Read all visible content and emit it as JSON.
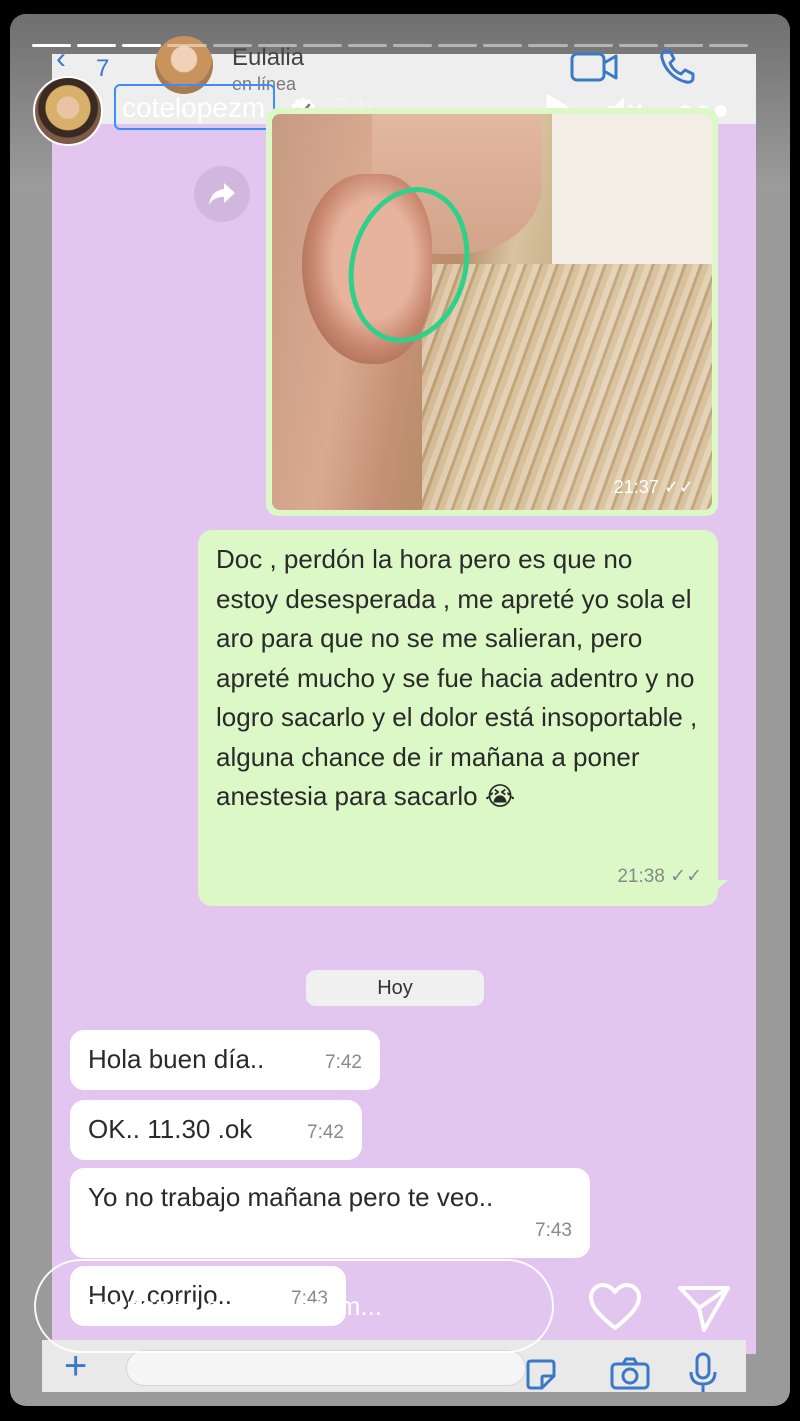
{
  "story": {
    "username": "cotelopezm",
    "time_ago": "7 h",
    "progress_segments": 16,
    "progress_current": 3,
    "reply_placeholder": "Responde a cotelopezm..."
  },
  "whatsapp": {
    "back_count": "7",
    "contact_name": "Eulalia",
    "contact_status": "en línea",
    "photo_time": "21:37",
    "messages": [
      {
        "text": "Doc , perdón la hora pero es que no estoy desesperada , me apreté yo sola el aro para que no se me salieran, pero apreté mucho y se fue hacia adentro y no logro sacarlo y el dolor está insoportable , alguna chance de ir mañana a poner anestesia para sacarlo 😭",
        "time": "21:38",
        "direction": "sent"
      },
      {
        "text": "Hola buen día..",
        "time": "7:42",
        "direction": "received"
      },
      {
        "text": "OK.. 11.30 .ok",
        "time": "7:42",
        "direction": "received"
      },
      {
        "text": "Yo no trabajo mañana pero te veo..",
        "time": "7:43",
        "direction": "received"
      },
      {
        "text": "Hoy..corrijo..",
        "time": "7:43",
        "direction": "received"
      }
    ],
    "day_label": "Hoy"
  },
  "colors": {
    "chat_background": "#e2c6ef",
    "sent_bubble": "#dcf8c6",
    "received_bubble": "#ffffff",
    "username_highlight": "#3a8dff",
    "accent_blue": "#3b79c7"
  }
}
